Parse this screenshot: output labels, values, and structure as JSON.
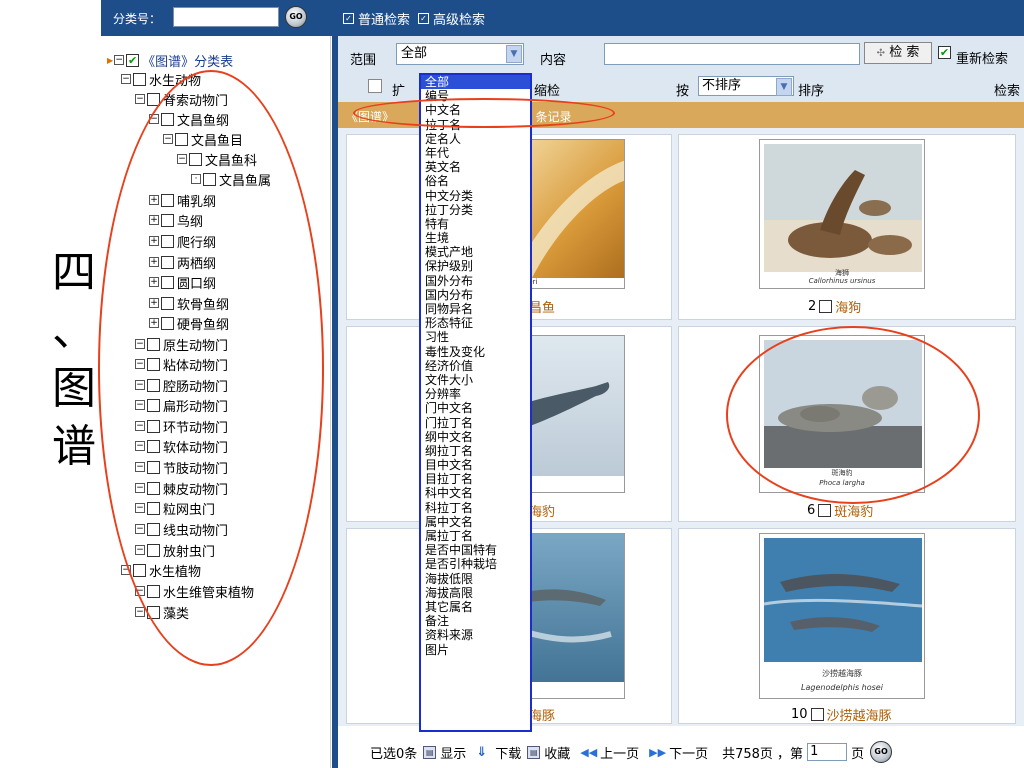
{
  "slide_title": "四\n、\n图\n谱",
  "sidebar": {
    "code_label": "分类号：",
    "go_label": "GO",
    "tree": [
      {
        "label": "《图谱》分类表",
        "level": 0,
        "checked": true,
        "root": true
      },
      {
        "label": "水生动物",
        "level": 1
      },
      {
        "label": "脊索动物门",
        "level": 2
      },
      {
        "label": "文昌鱼纲",
        "level": 3
      },
      {
        "label": "文昌鱼目",
        "level": 4
      },
      {
        "label": "文昌鱼科",
        "level": 5
      },
      {
        "label": "文昌鱼属",
        "level": 6
      },
      {
        "label": "哺乳纲",
        "level": 3
      },
      {
        "label": "鸟纲",
        "level": 3
      },
      {
        "label": "爬行纲",
        "level": 3
      },
      {
        "label": "两栖纲",
        "level": 3
      },
      {
        "label": "圆口纲",
        "level": 3
      },
      {
        "label": "软骨鱼纲",
        "level": 3
      },
      {
        "label": "硬骨鱼纲",
        "level": 3
      },
      {
        "label": "原生动物门",
        "level": 2
      },
      {
        "label": "粘体动物门",
        "level": 2
      },
      {
        "label": "腔肠动物门",
        "level": 2
      },
      {
        "label": "扁形动物门",
        "level": 2
      },
      {
        "label": "环节动物门",
        "level": 2
      },
      {
        "label": "软体动物门",
        "level": 2
      },
      {
        "label": "节肢动物门",
        "level": 2
      },
      {
        "label": "棘皮动物门",
        "level": 2
      },
      {
        "label": "粒网虫门",
        "level": 2
      },
      {
        "label": "线虫动物门",
        "level": 2
      },
      {
        "label": "放射虫门",
        "level": 2
      },
      {
        "label": "水生植物",
        "level": 1
      },
      {
        "label": "水生维管束植物",
        "level": 2
      },
      {
        "label": "藻类",
        "level": 2
      }
    ]
  },
  "modebar": {
    "normal": "普通检索",
    "advanced": "高级检索"
  },
  "search": {
    "range_label": "范围",
    "range_value": "全部",
    "content_label": "内容",
    "search_button": "检 索",
    "research_label": "重新检索",
    "expand_label": "扩",
    "shrink_label": "缩检",
    "by_label": "按",
    "sort_value": "不排序",
    "sort_label": "排序",
    "trail_label": "检索"
  },
  "results": {
    "bar_text_left": "《图谱》",
    "bar_text_right": "7 条记录"
  },
  "dropdown_options": [
    "全部",
    "编号",
    "中文名",
    "拉丁名",
    "定名人",
    "年代",
    "英文名",
    "俗名",
    "中文分类",
    "拉丁分类",
    "特有",
    "生境",
    "模式产地",
    "保护级别",
    "国外分布",
    "国内分布",
    "同物异名",
    "形态特征",
    "习性",
    "毒性及变化",
    "经济价值",
    "文件大小",
    "分辨率",
    "门中文名",
    "门拉丁名",
    "纲中文名",
    "纲拉丁名",
    "目中文名",
    "目拉丁名",
    "科中文名",
    "科拉丁名",
    "属中文名",
    "属拉丁名",
    "是否中国特有",
    "是否引种栽培",
    "海拔低限",
    "海拔高限",
    "其它属名",
    "备注",
    "资料来源",
    "图片"
  ],
  "cards": [
    {
      "num": "",
      "name": "昌鱼",
      "photo_cap": "lcheri"
    },
    {
      "num": "2",
      "name": "海狗",
      "photo_cap_cn": "海狮",
      "photo_cap": "Callorhinus ursinus"
    },
    {
      "num": "",
      "name": "海豹",
      "photo_cap": "ida"
    },
    {
      "num": "6",
      "name": "斑海豹",
      "photo_cap_cn": "斑海豹",
      "photo_cap": "Phoca largha"
    },
    {
      "num": "",
      "name": "海豚",
      "photo_cap": "us"
    },
    {
      "num": "10",
      "name": "沙捞越海豚",
      "photo_cap_cn": "沙捞越海豚",
      "photo_cap": "Lagenodelphis hosei"
    }
  ],
  "bottombar": {
    "selected": "已选0条",
    "show": "显示",
    "download": "下载",
    "favorite": "收藏",
    "prev": "上一页",
    "next": "下一页",
    "total": "共758页 ，第",
    "page_value": "1",
    "page_suffix": "页",
    "go_label": "GO"
  },
  "colors": {
    "nav_blue": "#1e4e8a",
    "search_bg": "#dce7f2",
    "result_bar": "#d9a85a",
    "annotation_red": "#e8401c",
    "dropdown_border": "#1a2ed0"
  }
}
